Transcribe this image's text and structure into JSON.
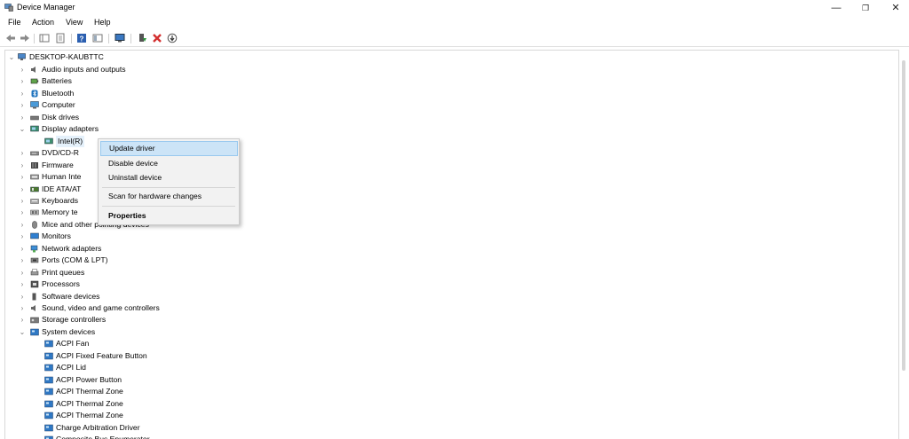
{
  "window": {
    "title": "Device Manager"
  },
  "menu": [
    "File",
    "Action",
    "View",
    "Help"
  ],
  "tree": {
    "root": "DESKTOP-KAUBTTC",
    "categories": [
      {
        "label": "Audio inputs and outputs",
        "icon": "speaker-icon",
        "expanded": false
      },
      {
        "label": "Batteries",
        "icon": "battery-icon",
        "expanded": false
      },
      {
        "label": "Bluetooth",
        "icon": "bluetooth-icon",
        "expanded": false
      },
      {
        "label": "Computer",
        "icon": "computer-icon",
        "expanded": false
      },
      {
        "label": "Disk drives",
        "icon": "disk-drive-icon",
        "expanded": false
      },
      {
        "label": "Display adapters",
        "icon": "display-adapter-icon",
        "expanded": true
      },
      {
        "label": "Intel(R)",
        "icon": "display-adapter-icon",
        "child": true,
        "selected": true
      },
      {
        "label": "DVD/CD-R",
        "icon": "dvd-icon",
        "expanded": false
      },
      {
        "label": "Firmware",
        "icon": "firmware-icon",
        "expanded": false
      },
      {
        "label": "Human Inte",
        "icon": "hid-icon",
        "expanded": false
      },
      {
        "label": "IDE ATA/AT",
        "icon": "ide-icon",
        "expanded": false
      },
      {
        "label": "Keyboards",
        "icon": "keyboard-icon",
        "expanded": false
      },
      {
        "label": "Memory te",
        "icon": "memory-icon",
        "expanded": false
      },
      {
        "label": "Mice and other pointing devices",
        "icon": "mouse-icon",
        "expanded": false
      },
      {
        "label": "Monitors",
        "icon": "monitor-icon",
        "expanded": false
      },
      {
        "label": "Network adapters",
        "icon": "network-icon",
        "expanded": false
      },
      {
        "label": "Ports (COM & LPT)",
        "icon": "port-icon",
        "expanded": false
      },
      {
        "label": "Print queues",
        "icon": "printer-icon",
        "expanded": false
      },
      {
        "label": "Processors",
        "icon": "processor-icon",
        "expanded": false
      },
      {
        "label": "Software devices",
        "icon": "software-device-icon",
        "expanded": false
      },
      {
        "label": "Sound, video and game controllers",
        "icon": "speaker-icon",
        "expanded": false
      },
      {
        "label": "Storage controllers",
        "icon": "storage-icon",
        "expanded": false
      },
      {
        "label": "System devices",
        "icon": "system-device-icon",
        "expanded": true
      },
      {
        "label": "ACPI Fan",
        "icon": "system-device-icon",
        "child": true
      },
      {
        "label": "ACPI Fixed Feature Button",
        "icon": "system-device-icon",
        "child": true
      },
      {
        "label": "ACPI Lid",
        "icon": "system-device-icon",
        "child": true
      },
      {
        "label": "ACPI Power Button",
        "icon": "system-device-icon",
        "child": true
      },
      {
        "label": "ACPI Thermal Zone",
        "icon": "system-device-icon",
        "child": true
      },
      {
        "label": "ACPI Thermal Zone",
        "icon": "system-device-icon",
        "child": true
      },
      {
        "label": "ACPI Thermal Zone",
        "icon": "system-device-icon",
        "child": true
      },
      {
        "label": "Charge Arbitration Driver",
        "icon": "system-device-icon",
        "child": true
      },
      {
        "label": "Composite Bus Enumerator",
        "icon": "system-device-icon",
        "child": true
      }
    ]
  },
  "context_menu": {
    "update": "Update driver",
    "disable": "Disable device",
    "uninstall": "Uninstall device",
    "scan": "Scan for hardware changes",
    "properties": "Properties"
  },
  "colors": {
    "selection": "#cce4f7",
    "selection_border": "#99c9ef",
    "close_red": "#d32f2f",
    "device_blue": "#1e73be"
  }
}
